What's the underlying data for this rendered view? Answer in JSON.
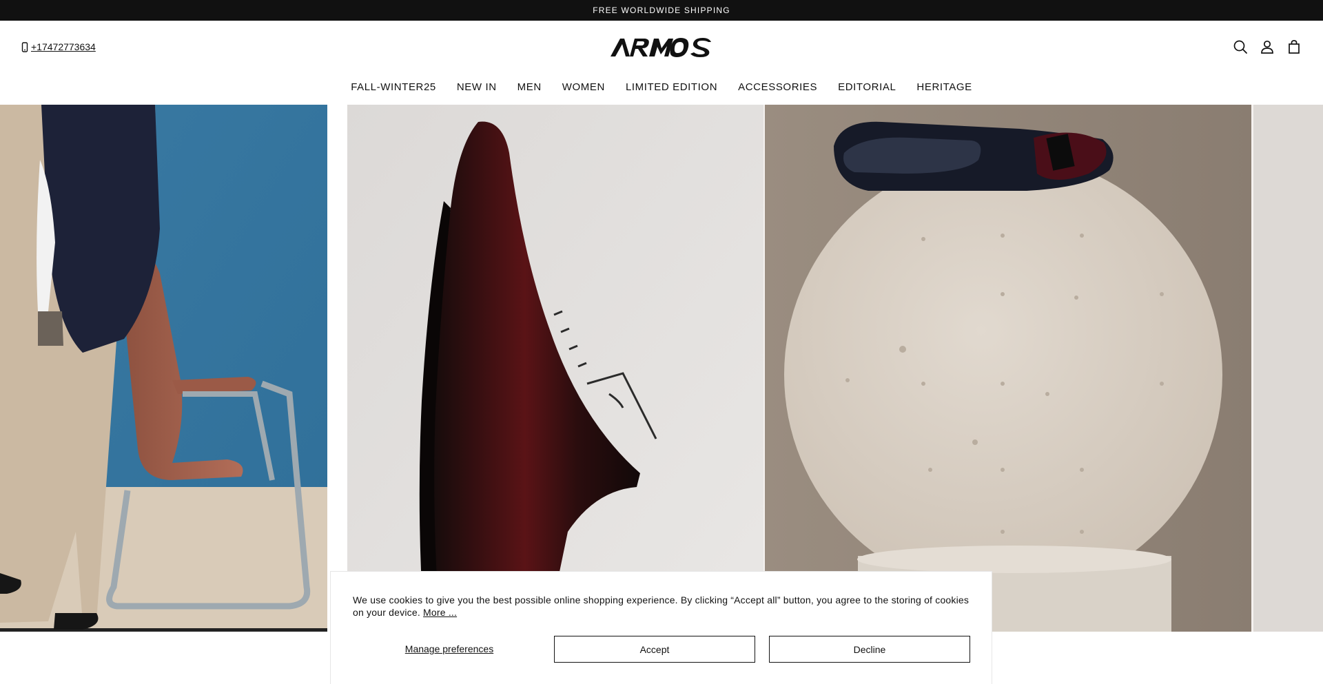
{
  "announcement": "FREE WORLDWIDE SHIPPING",
  "header": {
    "phone": "+17472773634",
    "logo_text": "ARMOS",
    "icons": [
      "search-icon",
      "account-icon",
      "cart-icon"
    ]
  },
  "nav": {
    "items": [
      "FALL-WINTER25",
      "NEW IN",
      "MEN",
      "WOMEN",
      "LIMITED EDITION",
      "ACCESSORIES",
      "EDITORIAL",
      "HERITAGE"
    ]
  },
  "cookie": {
    "text": "We use cookies to give you the best possible online shopping experience. By clicking “Accept all” button, you agree to the storing of cookies on your device.",
    "more_link": "More ...",
    "manage_label": "Manage preferences",
    "accept_label": "Accept",
    "decline_label": "Decline"
  },
  "colors": {
    "announcement_bg": "#111111",
    "hero_blue": "#3e7fa6",
    "hero_wall": "#e4e1de",
    "hero_stone": "#c9bcad"
  }
}
